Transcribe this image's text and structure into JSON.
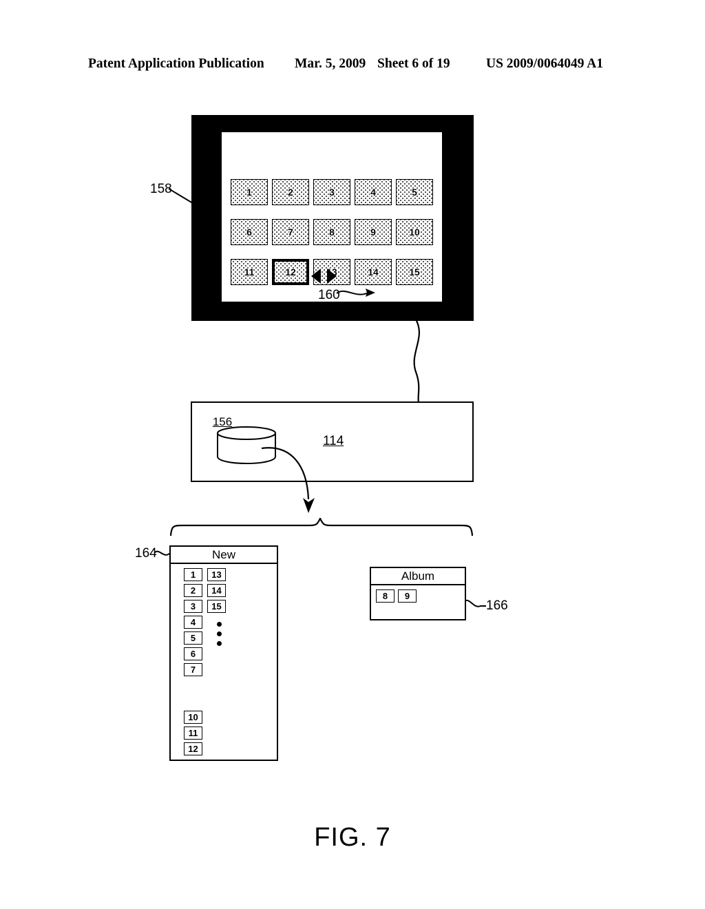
{
  "header": {
    "publication": "Patent Application Publication",
    "date": "Mar. 5, 2009",
    "sheet": "Sheet 6 of 19",
    "patent_number": "US 2009/0064049 A1"
  },
  "figure": {
    "caption": "FIG. 7"
  },
  "display_device": {
    "ref": "158",
    "thumbnails": [
      {
        "label": "1",
        "selected": false
      },
      {
        "label": "2",
        "selected": false
      },
      {
        "label": "3",
        "selected": false
      },
      {
        "label": "4",
        "selected": false
      },
      {
        "label": "5",
        "selected": false
      },
      {
        "label": "6",
        "selected": false
      },
      {
        "label": "7",
        "selected": false
      },
      {
        "label": "8",
        "selected": false
      },
      {
        "label": "9",
        "selected": false
      },
      {
        "label": "10",
        "selected": false
      },
      {
        "label": "11",
        "selected": false
      },
      {
        "label": "12",
        "selected": true
      },
      {
        "label": "13",
        "selected": false
      },
      {
        "label": "14",
        "selected": false
      },
      {
        "label": "15",
        "selected": false
      }
    ],
    "navigation": {
      "ref": "160",
      "prev_icon": "triangle-left-icon",
      "next_icon": "triangle-right-icon"
    }
  },
  "memory_box": {
    "ref": "114",
    "database": {
      "ref": "156",
      "icon": "database-cylinder-icon"
    }
  },
  "panels": [
    {
      "ref": "164",
      "title": "New",
      "left_column": [
        "1",
        "2",
        "3",
        "4",
        "5",
        "6",
        "7",
        "",
        "",
        "10",
        "11",
        "12"
      ],
      "right_column": [
        "13",
        "14",
        "15"
      ],
      "ellipsis": "vertical-dots"
    },
    {
      "ref": "166",
      "title": "Album",
      "items": [
        "8",
        "9"
      ]
    }
  ],
  "colors": {
    "ink": "#000000",
    "paper": "#ffffff"
  }
}
